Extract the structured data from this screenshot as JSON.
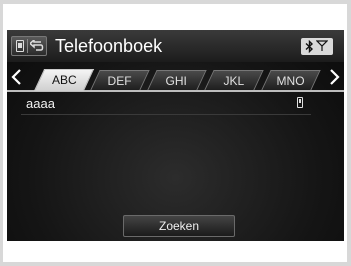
{
  "header": {
    "title": "Telefoonboek"
  },
  "tabs": [
    {
      "label": "ABC",
      "active": true
    },
    {
      "label": "DEF",
      "active": false
    },
    {
      "label": "GHI",
      "active": false
    },
    {
      "label": "JKL",
      "active": false
    },
    {
      "label": "MNO",
      "active": false
    }
  ],
  "contacts": [
    {
      "name": "aaaa",
      "icon": "mobile-phone-icon"
    }
  ],
  "footer": {
    "search_label": "Zoeken"
  },
  "colors": {
    "screen_bg": "#151515",
    "active_tab": "#e8e8e8",
    "text": "#f0f0f0"
  }
}
